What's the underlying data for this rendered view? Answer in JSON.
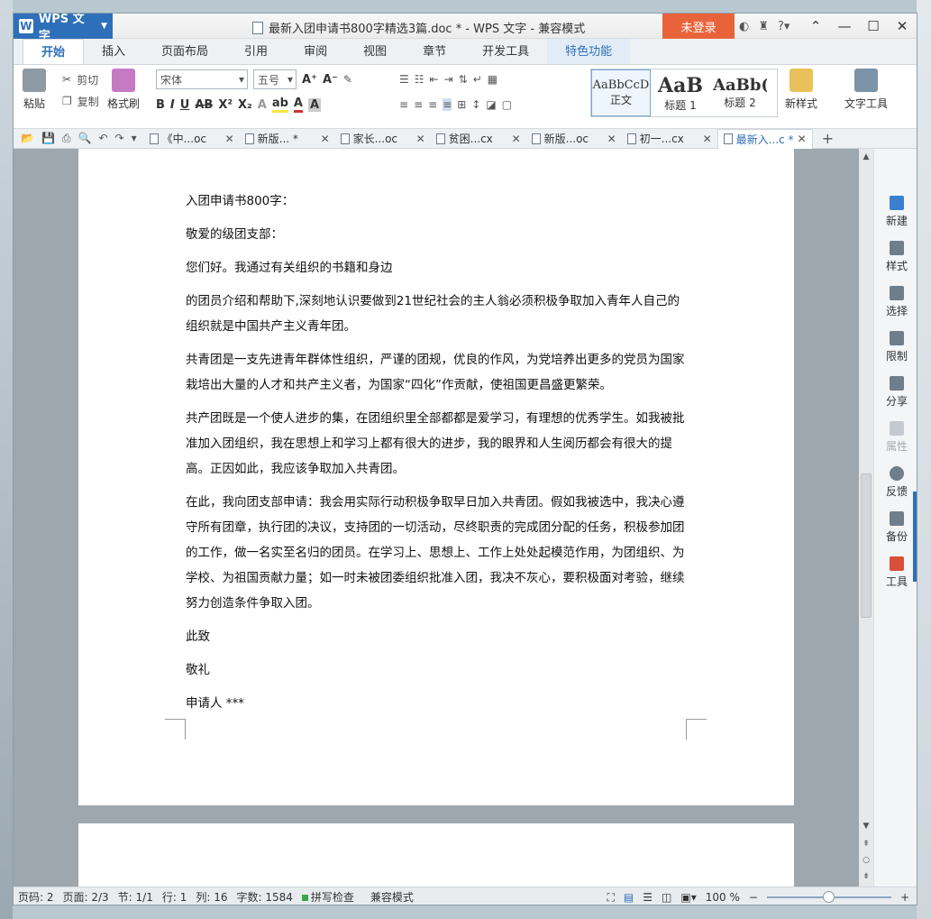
{
  "titlebar": {
    "app_name": "WPS 文字",
    "title": "最新入团申请书800字精选3篇.doc * - WPS 文字 - 兼容模式",
    "login": "未登录"
  },
  "ribbon_tabs": [
    "开始",
    "插入",
    "页面布局",
    "引用",
    "审阅",
    "视图",
    "章节",
    "开发工具",
    "特色功能"
  ],
  "ribbon": {
    "paste": "粘贴",
    "cut": "剪切",
    "copy": "复制",
    "format_painter": "格式刷",
    "font_name": "宋体",
    "font_size": "五号",
    "styles": [
      {
        "sample": "AaBbCcD",
        "label": "正文"
      },
      {
        "sample": "AaB",
        "label": "标题 1"
      },
      {
        "sample": "AaBb(",
        "label": "标题 2"
      }
    ],
    "new_style": "新样式",
    "text_tools": "文字工具"
  },
  "doc_tabs": [
    {
      "name": "《中...oc"
    },
    {
      "name": "新版... *"
    },
    {
      "name": "家长...oc"
    },
    {
      "name": "贫困...cx"
    },
    {
      "name": "新版...oc"
    },
    {
      "name": "初一...cx"
    },
    {
      "name": "最新入...c *"
    }
  ],
  "document": {
    "paragraphs": [
      "入团申请书800字：",
      "敬爱的级团支部：",
      "您们好。我通过有关组织的书籍和身边",
      "的团员介绍和帮助下,深刻地认识要做到21世纪社会的主人翁必须积极争取加入青年人自己的组织就是中国共产主义青年团。",
      "共青团是一支先进青年群体性组织，严谨的团规，优良的作风，为党培养出更多的党员为国家栽培出大量的人才和共产主义者，为国家“四化”作贡献，使祖国更昌盛更繁荣。",
      "共产团既是一个使人进步的集，在团组织里全部都都是爱学习，有理想的优秀学生。如我被批准加入团组织，我在思想上和学习上都有很大的进步，我的眼界和人生阅历都会有很大的提高。正因如此，我应该争取加入共青团。",
      "在此，我向团支部申请：我会用实际行动积极争取早日加入共青团。假如我被选中，我决心遵守所有团章，执行团的决议，支持团的一切活动，尽终职责的完成团分配的任务，积极参加团的工作，做一名实至名归的团员。在学习上、思想上、工作上处处起模范作用，为团组织、为学校、为祖国贡献力量；如一时未被团委组织批准入团，我决不灰心，要积极面对考验，继续努力创造条件争取入团。",
      "此致",
      "敬礼",
      "申请人 ***"
    ]
  },
  "right_panel": [
    "新建",
    "样式",
    "选择",
    "限制",
    "分享",
    "属性",
    "反馈",
    "备份",
    "工具"
  ],
  "statusbar": {
    "page_code": "页码: 2",
    "pages": "页面: 2/3",
    "section": "节: 1/1",
    "row": "行: 1",
    "col": "列: 16",
    "word_count": "字数: 1584",
    "spell_check": "拼写检查",
    "compat_mode": "兼容模式",
    "zoom": "100 %"
  },
  "colors": {
    "accent": "#2e6fb9",
    "login": "#e9633a"
  }
}
